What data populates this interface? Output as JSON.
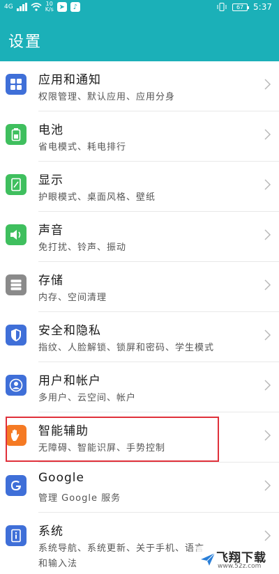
{
  "status_bar": {
    "network_type": "4G",
    "net_speed_value": "10",
    "net_speed_unit": "K/s",
    "battery_level": "67",
    "time": "5:37"
  },
  "header": {
    "title": "设置"
  },
  "colors": {
    "header": "#1bb0b8",
    "apps_icon": "#3f6fd8",
    "battery_icon": "#3fbf5e",
    "display_icon": "#3fbf5e",
    "sound_icon": "#3fbf5e",
    "storage_icon": "#8a8a8a",
    "security_icon": "#3f6fd8",
    "accounts_icon": "#3f6fd8",
    "assist_icon": "#f57a24",
    "google_icon": "#3f6fd8",
    "system_icon": "#3f6fd8",
    "highlight": "#e0303a"
  },
  "settings": [
    {
      "name": "应用和通知",
      "desc": "权限管理、默认应用、应用分身",
      "icon": "apps-grid-icon"
    },
    {
      "name": "电池",
      "desc": "省电模式、耗电排行",
      "icon": "battery-icon"
    },
    {
      "name": "显示",
      "desc": "护眼模式、桌面风格、壁纸",
      "icon": "display-icon"
    },
    {
      "name": "声音",
      "desc": "免打扰、铃声、振动",
      "icon": "speaker-icon"
    },
    {
      "name": "存储",
      "desc": "内存、空间清理",
      "icon": "storage-icon"
    },
    {
      "name": "安全和隐私",
      "desc": "指纹、人脸解锁、锁屏和密码、学生模式",
      "icon": "shield-icon"
    },
    {
      "name": "用户和帐户",
      "desc": "多用户、云空间、帐户",
      "icon": "user-icon"
    },
    {
      "name": "智能辅助",
      "desc": "无障碍、智能识屏、手势控制",
      "icon": "hand-icon"
    },
    {
      "name": "Google",
      "desc": "管理 Google 服务",
      "icon": "google-icon"
    },
    {
      "name": "系统",
      "desc": "系统导航、系统更新、关于手机、语言",
      "desc2": "和输入法",
      "icon": "system-info-icon"
    }
  ],
  "watermark": {
    "brand": "飞翔下载",
    "url": "www.52z.com"
  }
}
